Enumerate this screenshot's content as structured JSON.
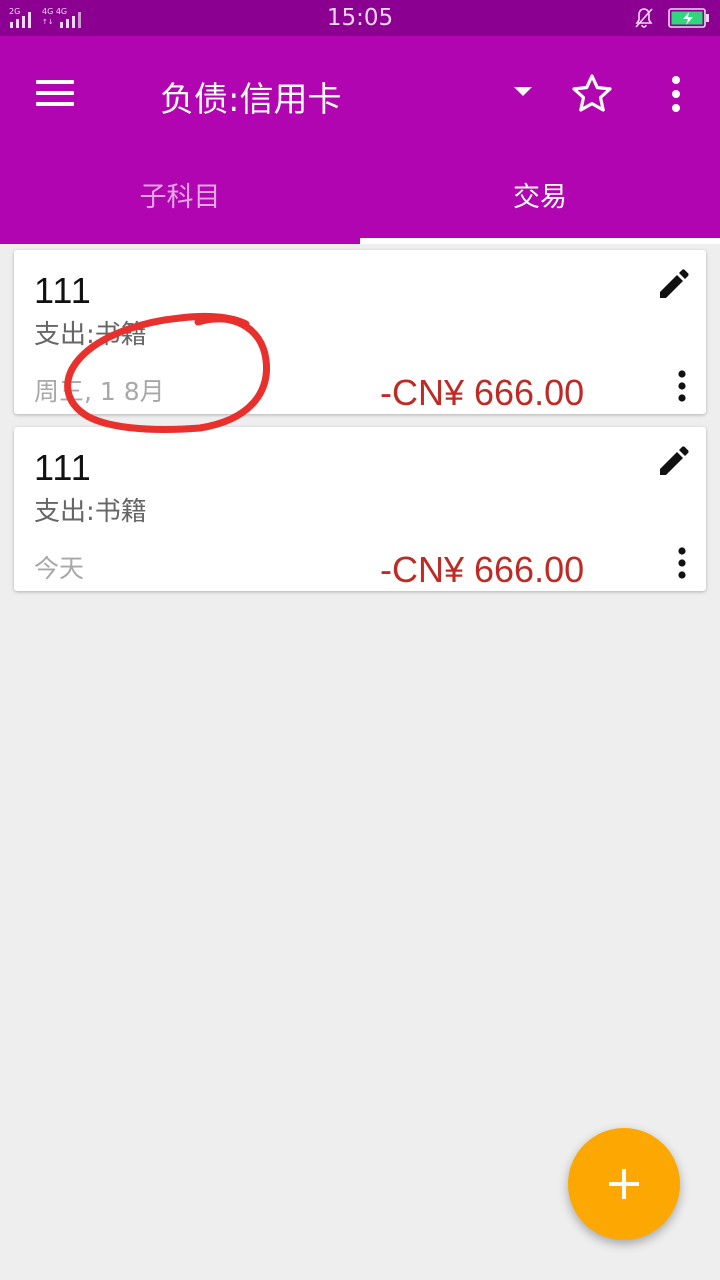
{
  "status_bar": {
    "network_left": "2G",
    "network_right": "4G 4G",
    "time": "15:05",
    "icons": [
      "signal-icon",
      "mute-bell-icon",
      "battery-charging-icon"
    ]
  },
  "app_bar": {
    "title": "负债:信用卡",
    "icons": [
      "menu-icon",
      "dropdown-arrow-icon",
      "star-outline-icon",
      "more-vert-icon"
    ],
    "background": "#b005b0"
  },
  "tabs": [
    {
      "label": "子科目",
      "selected": false
    },
    {
      "label": "交易",
      "selected": true
    }
  ],
  "transactions": [
    {
      "title": "111",
      "account": "支出:书籍",
      "date": "周三, 1 8月",
      "amount": "-CN¥ 666.00"
    },
    {
      "title": "111",
      "account": "支出:书籍",
      "date": "今天",
      "amount": "-CN¥ 666.00"
    }
  ],
  "fab": {
    "icon": "plus-icon",
    "color": "#fda802"
  },
  "colors": {
    "amount_negative": "#c02a24",
    "annotation": "#e8302c"
  }
}
